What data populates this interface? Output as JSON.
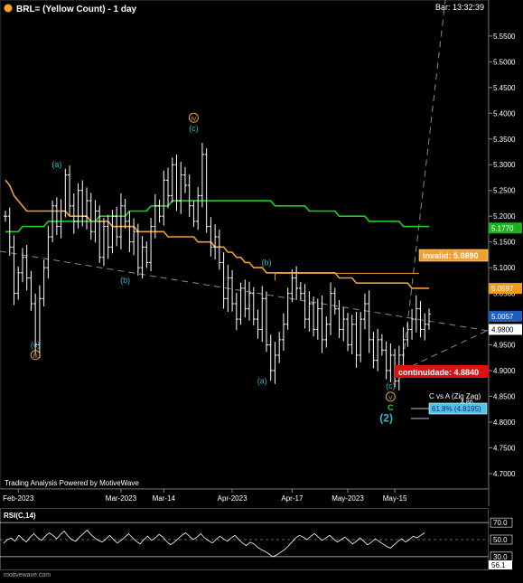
{
  "header": {
    "title": "BRL= (Yellow Count) - 1 day",
    "bar_time": "Bar: 13:32:39",
    "title_dot_color": "#f5a623"
  },
  "watermark": "Trading Analysis Powered by MotiveWave",
  "footer_site": "motivewave.com",
  "rsi": {
    "title": "RSI(C,14)",
    "levels": [
      70.0,
      50.0,
      30.0
    ],
    "level_labels": [
      "70.0",
      "50.0",
      "30.0"
    ],
    "current_label": "56.1",
    "values": [
      46,
      50,
      52,
      48,
      55,
      51,
      47,
      53,
      57,
      52,
      49,
      54,
      58,
      55,
      51,
      56,
      60,
      54,
      50,
      48,
      53,
      57,
      61,
      56,
      52,
      49,
      47,
      51,
      55,
      50,
      46,
      49,
      53,
      57,
      52,
      48,
      45,
      50,
      54,
      49,
      52,
      56,
      53,
      48,
      44,
      47,
      51,
      55,
      58,
      54,
      50,
      53,
      57,
      52,
      49,
      46,
      50,
      54,
      51,
      48,
      52,
      55,
      50,
      46,
      43,
      47,
      45,
      41,
      38,
      36,
      33,
      30,
      32,
      35,
      38,
      42,
      47,
      52,
      55,
      53,
      50,
      54,
      57,
      53,
      49,
      52,
      55,
      51,
      47,
      50,
      53,
      49,
      45,
      48,
      52,
      48,
      44,
      47,
      51,
      48,
      45,
      42,
      40,
      44,
      48,
      51,
      47,
      50,
      54,
      52,
      55,
      58
    ]
  },
  "chart_data": {
    "type": "ohlc",
    "title": "BRL= (Yellow Count) - 1 day",
    "ylim": [
      4.67,
      5.62
    ],
    "y_ticks": [
      4.7,
      4.75,
      4.8,
      4.85,
      4.9,
      4.95,
      5.0,
      5.05,
      5.1,
      5.15,
      5.2,
      5.25,
      5.3,
      5.35,
      5.4,
      5.45,
      5.5,
      5.55
    ],
    "y_tick_labels": [
      "4.7000",
      "4.7500",
      "4.8000",
      "4.8500",
      "4.9000",
      "4.9500",
      "5.0000",
      "5.0500",
      "5.1000",
      "5.1500",
      "5.2000",
      "5.2500",
      "5.3000",
      "5.3500",
      "5.4000",
      "5.4500",
      "5.5000",
      "5.5500"
    ],
    "x_labels": [
      "Feb-2023",
      "Mar-2023",
      "Mar-14",
      "Apr-2023",
      "Apr-17",
      "May-2023",
      "May-15"
    ],
    "x_label_bars": [
      3,
      27,
      37,
      53,
      67,
      80,
      91
    ],
    "bar_count": 100,
    "closes": [
      5.2,
      5.14,
      5.05,
      5.09,
      5.12,
      5.08,
      5.03,
      4.95,
      5.04,
      5.1,
      5.16,
      5.22,
      5.18,
      5.21,
      5.28,
      5.22,
      5.19,
      5.25,
      5.2,
      5.23,
      5.17,
      5.21,
      5.12,
      5.18,
      5.14,
      5.2,
      5.16,
      5.22,
      5.19,
      5.15,
      5.17,
      5.1,
      5.14,
      5.11,
      5.18,
      5.22,
      5.2,
      5.27,
      5.24,
      5.3,
      5.23,
      5.28,
      5.26,
      5.22,
      5.19,
      5.24,
      5.32,
      5.18,
      5.14,
      5.16,
      5.11,
      5.04,
      5.08,
      5.03,
      5.0,
      5.06,
      5.02,
      5.05,
      5.0,
      4.98,
      5.04,
      4.95,
      4.9,
      4.93,
      4.96,
      4.99,
      5.05,
      5.08,
      5.06,
      5.05,
      5.0,
      5.03,
      4.98,
      5.02,
      4.96,
      4.99,
      5.05,
      5.02,
      4.98,
      5.0,
      4.95,
      4.99,
      4.93,
      5.0,
      5.03,
      4.96,
      4.92,
      4.96,
      4.94,
      4.9,
      4.93,
      4.88,
      4.93,
      4.96,
      4.98,
      5.0,
      5.02,
      4.98,
      4.99,
      5.01
    ],
    "series": [
      {
        "name": "",
        "kind": "moving-average",
        "color": "#f0a030",
        "values": [
          5.27,
          5.26,
          5.24,
          5.23,
          5.22,
          5.21,
          5.21,
          5.21,
          5.21,
          5.21,
          5.21,
          5.21,
          5.21,
          5.21,
          5.21,
          5.2,
          5.2,
          5.2,
          5.2,
          5.2,
          5.19,
          5.19,
          5.19,
          5.19,
          5.19,
          5.18,
          5.18,
          5.18,
          5.18,
          5.18,
          5.18,
          5.17,
          5.17,
          5.17,
          5.17,
          5.17,
          5.17,
          5.17,
          5.16,
          5.16,
          5.16,
          5.16,
          5.16,
          5.16,
          5.16,
          5.15,
          5.15,
          5.15,
          5.15,
          5.14,
          5.14,
          5.14,
          5.13,
          5.13,
          5.12,
          5.12,
          5.11,
          5.11,
          5.1,
          5.1,
          5.1,
          5.09,
          5.09,
          5.09,
          5.09,
          5.09,
          5.09,
          5.09,
          5.09,
          5.09,
          5.09,
          5.09,
          5.09,
          5.09,
          5.09,
          5.09,
          5.09,
          5.09,
          5.08,
          5.08,
          5.08,
          5.08,
          5.07,
          5.07,
          5.07,
          5.07,
          5.07,
          5.07,
          5.07,
          5.07,
          5.07,
          5.07,
          5.07,
          5.07,
          5.07,
          5.06,
          5.06,
          5.06,
          5.06,
          5.06
        ]
      },
      {
        "name": "",
        "kind": "moving-average",
        "color": "#22cc22",
        "values": [
          5.17,
          5.17,
          5.17,
          5.17,
          5.18,
          5.18,
          5.18,
          5.18,
          5.18,
          5.18,
          5.19,
          5.19,
          5.19,
          5.19,
          5.19,
          5.19,
          5.19,
          5.19,
          5.19,
          5.19,
          5.19,
          5.19,
          5.2,
          5.2,
          5.2,
          5.2,
          5.2,
          5.2,
          5.2,
          5.21,
          5.21,
          5.21,
          5.21,
          5.21,
          5.22,
          5.22,
          5.22,
          5.22,
          5.22,
          5.23,
          5.23,
          5.23,
          5.23,
          5.23,
          5.23,
          5.23,
          5.23,
          5.23,
          5.23,
          5.23,
          5.23,
          5.23,
          5.23,
          5.23,
          5.23,
          5.23,
          5.23,
          5.23,
          5.23,
          5.23,
          5.23,
          5.23,
          5.23,
          5.22,
          5.22,
          5.22,
          5.22,
          5.22,
          5.22,
          5.22,
          5.22,
          5.21,
          5.21,
          5.21,
          5.21,
          5.21,
          5.21,
          5.21,
          5.2,
          5.2,
          5.2,
          5.2,
          5.2,
          5.2,
          5.2,
          5.19,
          5.19,
          5.19,
          5.19,
          5.19,
          5.19,
          5.19,
          5.19,
          5.18,
          5.18,
          5.18,
          5.18,
          5.18,
          5.18,
          5.18
        ]
      }
    ],
    "price_labels": [
      {
        "text": "5.1770",
        "value": 5.177,
        "bg": "#1db31d",
        "fg": "#ffffff"
      },
      {
        "text": "5.0597",
        "value": 5.0597,
        "bg": "#f09a20",
        "fg": "#ffffff"
      },
      {
        "text": "5.0057",
        "value": 5.0057,
        "bg": "#1c5fbf",
        "fg": "#ffffff"
      },
      {
        "text": "4.9800",
        "value": 4.98,
        "bg": "#ffffff",
        "fg": "#000000"
      }
    ],
    "annotations": [
      {
        "text": "(a)",
        "bar": 12,
        "value": 5.295,
        "color": "#3ab5c8"
      },
      {
        "text": "(b)",
        "bar": 28,
        "value": 5.07,
        "color": "#3ab5c8"
      },
      {
        "text": "(c)",
        "bar": 7,
        "value": 4.945,
        "color": "#3ab5c8"
      },
      {
        "text": "III",
        "bar": 7,
        "value": 4.925,
        "color": "#f0a030",
        "circled": true
      },
      {
        "text": "IV",
        "bar": 44,
        "value": 5.386,
        "color": "#f0a030",
        "circled": true
      },
      {
        "text": "(c)",
        "bar": 44,
        "value": 5.365,
        "color": "#3ab5c8"
      },
      {
        "text": "(a)",
        "bar": 60,
        "value": 4.875,
        "color": "#3ab5c8"
      },
      {
        "text": "(b)",
        "bar": 61,
        "value": 5.105,
        "color": "#3ab5c8"
      },
      {
        "text": "(c)",
        "bar": 90,
        "value": 4.865,
        "color": "#3ab5c8"
      },
      {
        "text": "V",
        "bar": 90,
        "value": 4.844,
        "color": "#f0a030",
        "circled": true
      },
      {
        "text": "C",
        "bar": 90,
        "value": 4.823,
        "color": "#22cc22"
      },
      {
        "text": "(2)",
        "bar": 89,
        "value": 4.801,
        "color": "#3ab5c8"
      }
    ],
    "callouts": {
      "invalid": {
        "text": "Invalid: 5.0890",
        "value": 5.089,
        "from_bar": 63
      },
      "continuidade": {
        "text": "continuidade: 4.8840",
        "value": 4.884
      },
      "cvsa_title": "C vs A (Zig Zag)",
      "cvsa_value_text": "4.86",
      "cvsa_box": "61.8% (4.8195)",
      "cvsa_value": 4.8195
    }
  }
}
